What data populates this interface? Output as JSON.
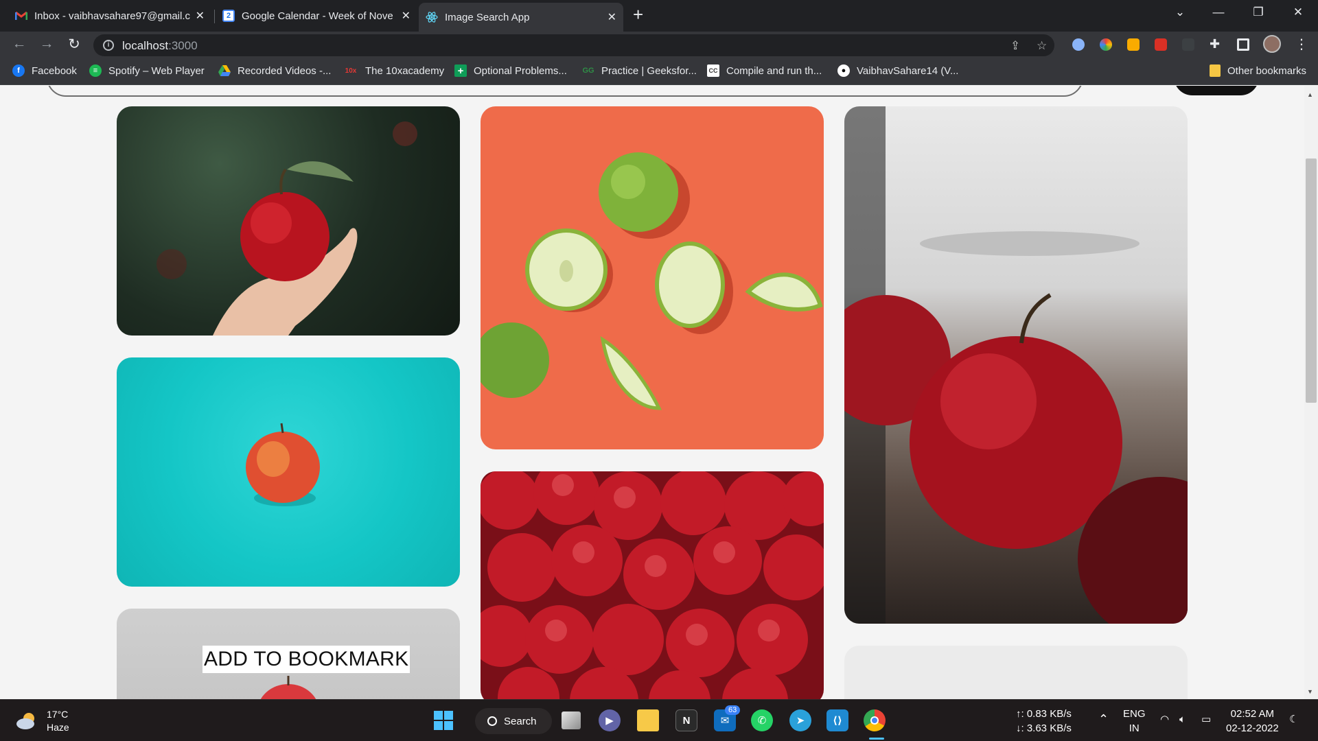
{
  "browser": {
    "tabs": [
      {
        "title": "Inbox - vaibhavsahare97@gmail.c",
        "icon": "gmail-icon",
        "active": false
      },
      {
        "title": "Google Calendar - Week of Nove",
        "icon": "google-calendar-icon",
        "active": false
      },
      {
        "title": "Image Search App",
        "icon": "react-icon",
        "active": true
      }
    ],
    "calendar_icon_text": "2",
    "address_bar": {
      "host": "localhost",
      "port": ":3000"
    },
    "bookmarks": [
      {
        "label": "Facebook",
        "icon": "facebook-icon"
      },
      {
        "label": "Spotify – Web Player",
        "icon": "spotify-icon"
      },
      {
        "label": "Recorded Videos -...",
        "icon": "google-drive-icon"
      },
      {
        "label": "The 10xacademy",
        "icon": "10x-icon"
      },
      {
        "label": "Optional Problems...",
        "icon": "plus-sheet-icon"
      },
      {
        "label": "Practice | Geeksfor...",
        "icon": "geeksforgeeks-icon"
      },
      {
        "label": "Compile and run th...",
        "icon": "cc-icon"
      },
      {
        "label": "VaibhavSahare14 (V...",
        "icon": "github-icon"
      }
    ],
    "other_bookmarks": "Other bookmarks",
    "cc_icon_text": "CC",
    "gfg_icon_text": "GG",
    "tenx_icon_text": "10x"
  },
  "app": {
    "images": [
      {
        "name": "hand-holding-red-apple",
        "alt": "Hand holding a red apple"
      },
      {
        "name": "green-apple-slices-on-orange",
        "alt": "Green apple slices on orange background"
      },
      {
        "name": "red-apple-on-wooden-table",
        "alt": "Red apple on a wooden table"
      },
      {
        "name": "apple-on-teal",
        "alt": "Apple on teal background"
      },
      {
        "name": "pile-of-red-apples",
        "alt": "Pile of red apples"
      },
      {
        "name": "apple-on-grey",
        "alt": "Apple on grey background"
      },
      {
        "name": "light-image-placeholder",
        "alt": "Light image"
      }
    ],
    "bookmark_button": "ADD TO BOOKMARK"
  },
  "taskbar": {
    "weather": {
      "temp": "17°C",
      "condition": "Haze"
    },
    "search_label": "Search",
    "mail_badge": "63",
    "network": {
      "up": "↑: 0.83 KB/s",
      "down": "↓: 3.63 KB/s"
    },
    "language": {
      "lang": "ENG",
      "region": "IN"
    },
    "clock": {
      "time": "02:52 AM",
      "date": "02-12-2022"
    }
  },
  "colors": {
    "chrome_dark": "#202124",
    "chrome_toolbar": "#35363a",
    "page_bg": "#f4f4f4",
    "teal": "#14c6c6",
    "orange": "#ef6b4a",
    "taskbar": "#1f1b1c"
  }
}
